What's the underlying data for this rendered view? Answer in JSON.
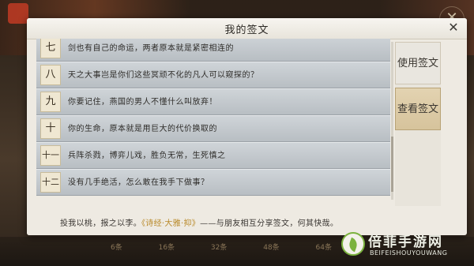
{
  "background": {
    "close_glyph": "✕",
    "counts": [
      "6条",
      "16条",
      "32条",
      "48条",
      "64条"
    ]
  },
  "dialog": {
    "title": "我的签文",
    "close_glyph": "✕",
    "items": [
      {
        "num": "七",
        "text": "剑也有自己的命运，两者原本就是紧密相连的"
      },
      {
        "num": "八",
        "text": "天之大事岂是你们这些冥顽不化的凡人可以窥探的？"
      },
      {
        "num": "九",
        "text": "你要记住，燕国的男人不懂什么叫放弃！"
      },
      {
        "num": "十",
        "text": "你的生命，原本就是用巨大的代价换取的"
      },
      {
        "num": "十一",
        "text": "兵阵杀戮，博弈儿戏，胜负无常，生死慎之"
      },
      {
        "num": "十二",
        "text": "没有几手绝活，怎么敢在我手下做事？"
      }
    ],
    "footer": {
      "prefix": "投我以桃，报之以李。",
      "highlight": "《诗经·大雅·抑》",
      "suffix": "——与朋友相互分享签文，何其快哉。"
    },
    "side_buttons": [
      {
        "label": "使用签文",
        "active": false
      },
      {
        "label": "查看签文",
        "active": true
      }
    ]
  },
  "watermark": {
    "name": "倍菲手游网",
    "sub": "BEIFEISHOUYOUWANG"
  }
}
